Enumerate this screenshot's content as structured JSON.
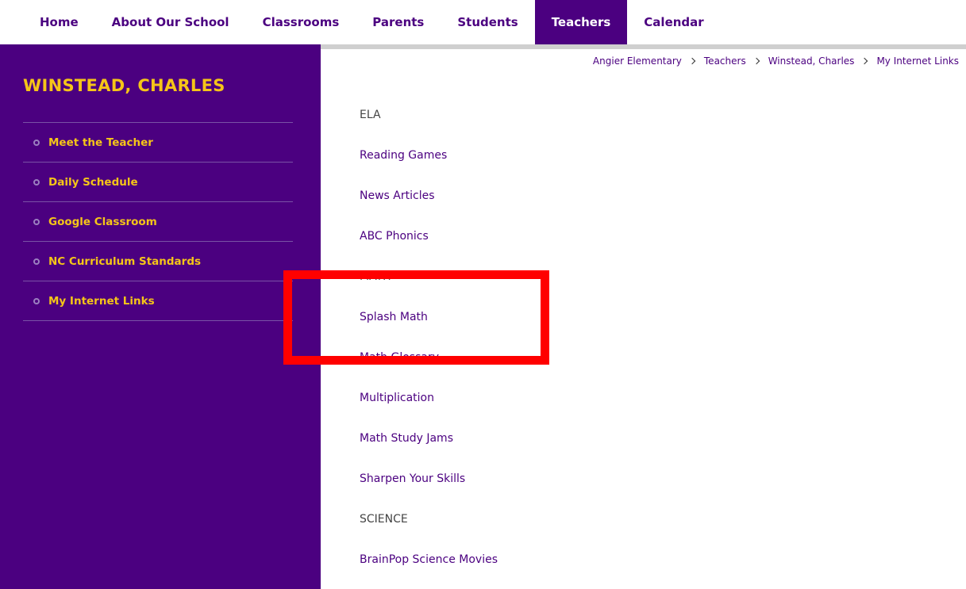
{
  "nav": {
    "items": [
      {
        "label": "Home",
        "active": false
      },
      {
        "label": "About Our School",
        "active": false
      },
      {
        "label": "Classrooms",
        "active": false
      },
      {
        "label": "Parents",
        "active": false
      },
      {
        "label": "Students",
        "active": false
      },
      {
        "label": "Teachers",
        "active": true
      },
      {
        "label": "Calendar",
        "active": false
      }
    ]
  },
  "sidebar": {
    "title": "WINSTEAD, CHARLES",
    "items": [
      {
        "label": "Meet the Teacher"
      },
      {
        "label": "Daily Schedule"
      },
      {
        "label": "Google Classroom"
      },
      {
        "label": "NC Curriculum Standards"
      },
      {
        "label": "My Internet Links"
      }
    ]
  },
  "breadcrumb": {
    "items": [
      "Angier Elementary",
      "Teachers",
      "Winstead, Charles",
      "My Internet Links"
    ]
  },
  "content": {
    "entries": [
      {
        "text": "ELA",
        "type": "heading"
      },
      {
        "text": "Reading Games",
        "type": "link"
      },
      {
        "text": "News Articles",
        "type": "link"
      },
      {
        "text": "ABC Phonics",
        "type": "link"
      },
      {
        "text": "MATH",
        "type": "heading"
      },
      {
        "text": "Splash Math",
        "type": "link"
      },
      {
        "text": "Math Glossary",
        "type": "link"
      },
      {
        "text": "Multiplication",
        "type": "link"
      },
      {
        "text": "Math Study Jams",
        "type": "link"
      },
      {
        "text": "Sharpen Your Skills",
        "type": "link"
      },
      {
        "text": "SCIENCE",
        "type": "heading"
      },
      {
        "text": "BrainPop Science Movies",
        "type": "link"
      }
    ]
  },
  "colors": {
    "brand_purple": "#4b0080",
    "accent_gold": "#f5c518",
    "highlight_red": "#ff0000"
  }
}
